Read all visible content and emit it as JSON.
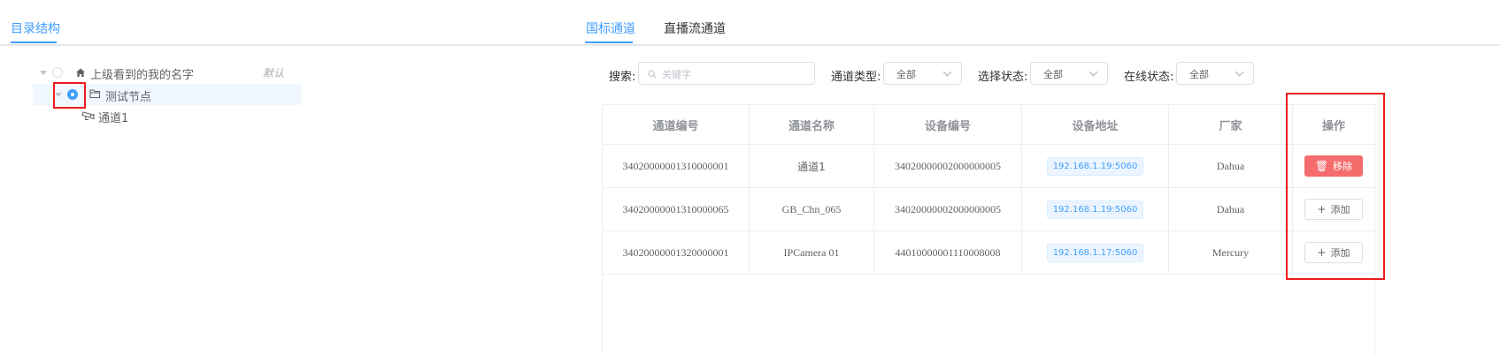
{
  "left": {
    "tab_label": "目录结构",
    "tree": {
      "root_label": "上级看到的我的名字",
      "root_default": "默认",
      "node_label": "测试节点",
      "leaf_label": "通道1"
    }
  },
  "right": {
    "tabs": [
      "国标通道",
      "直播流通道"
    ],
    "filters": {
      "search_label": "搜索:",
      "search_placeholder": "关键字",
      "channel_type_label": "通道类型:",
      "channel_type_value": "全部",
      "select_state_label": "选择状态:",
      "select_state_value": "全部",
      "online_state_label": "在线状态:",
      "online_state_value": "全部"
    },
    "table": {
      "headers": [
        "通道编号",
        "通道名称",
        "设备编号",
        "设备地址",
        "厂家",
        "操作"
      ],
      "rows": [
        {
          "channel_id": "34020000001310000001",
          "channel_name": "通道1",
          "device_id": "34020000002000000005",
          "address": "192.168.1.19:5060",
          "vendor": "Dahua",
          "action": "移除",
          "action_type": "remove"
        },
        {
          "channel_id": "34020000001310000065",
          "channel_name": "GB_Chn_065",
          "device_id": "34020000002000000005",
          "address": "192.168.1.19:5060",
          "vendor": "Dahua",
          "action": "添加",
          "action_type": "add"
        },
        {
          "channel_id": "34020000001320000001",
          "channel_name": "IPCamera 01",
          "device_id": "44010000001110008008",
          "address": "192.168.1.17:5060",
          "vendor": "Mercury",
          "action": "添加",
          "action_type": "add"
        }
      ]
    }
  },
  "colors": {
    "accent": "#409eff",
    "danger": "#f56c6c",
    "highlight_box": "#f01c1c"
  },
  "icons": [
    "home-icon",
    "folder-icon",
    "camera-icon",
    "search-icon",
    "chevron-down-icon",
    "trash-icon",
    "plus-icon"
  ]
}
